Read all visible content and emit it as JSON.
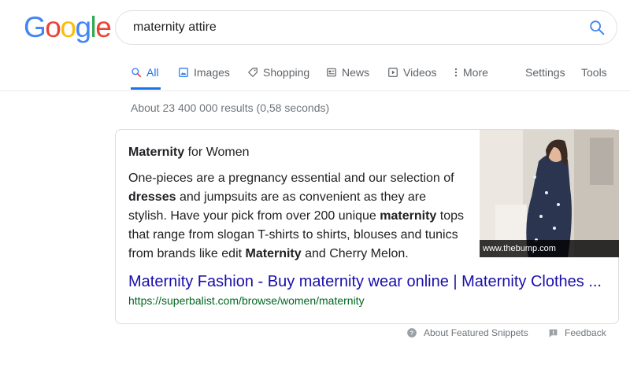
{
  "logo": {
    "letters": [
      "G",
      "o",
      "o",
      "g",
      "l",
      "e"
    ],
    "colors": [
      "#4285F4",
      "#EA4335",
      "#FBBC05",
      "#4285F4",
      "#34A853",
      "#EA4335"
    ]
  },
  "search": {
    "query": "maternity attire",
    "icon": "search-icon",
    "accent": "#4285F4"
  },
  "tabs": [
    {
      "label": "All",
      "icon": "search-icon",
      "active": true
    },
    {
      "label": "Images",
      "icon": "image-icon",
      "active": false
    },
    {
      "label": "Shopping",
      "icon": "tag-icon",
      "active": false
    },
    {
      "label": "News",
      "icon": "news-icon",
      "active": false
    },
    {
      "label": "Videos",
      "icon": "play-icon",
      "active": false
    },
    {
      "label": "More",
      "icon": "more-vert-icon",
      "active": false
    }
  ],
  "tools": {
    "settings": "Settings",
    "tools": "Tools"
  },
  "result_stats": "About 23 400 000 results (0,58 seconds)",
  "snippet": {
    "title_bold": "Maternity",
    "title_rest": " for Women",
    "text": [
      {
        "t": "One-pieces are a pregnancy essential and our selection of ",
        "b": false
      },
      {
        "t": "dresses",
        "b": true
      },
      {
        "t": " and jumpsuits are as convenient as they are stylish. Have your pick from over 200 unique ",
        "b": false
      },
      {
        "t": "maternity",
        "b": true
      },
      {
        "t": " tops that range from slogan T-shirts to shirts, blouses and tunics from brands like edit ",
        "b": false
      },
      {
        "t": "Maternity",
        "b": true
      },
      {
        "t": " and Cherry Melon.",
        "b": false
      }
    ],
    "image_caption": "www.thebump.com",
    "link_title": "Maternity Fashion - Buy maternity wear online | Maternity Clothes ...",
    "url": "https://superbalist.com/browse/women/maternity"
  },
  "footer": {
    "about": "About Featured Snippets",
    "feedback": "Feedback"
  }
}
